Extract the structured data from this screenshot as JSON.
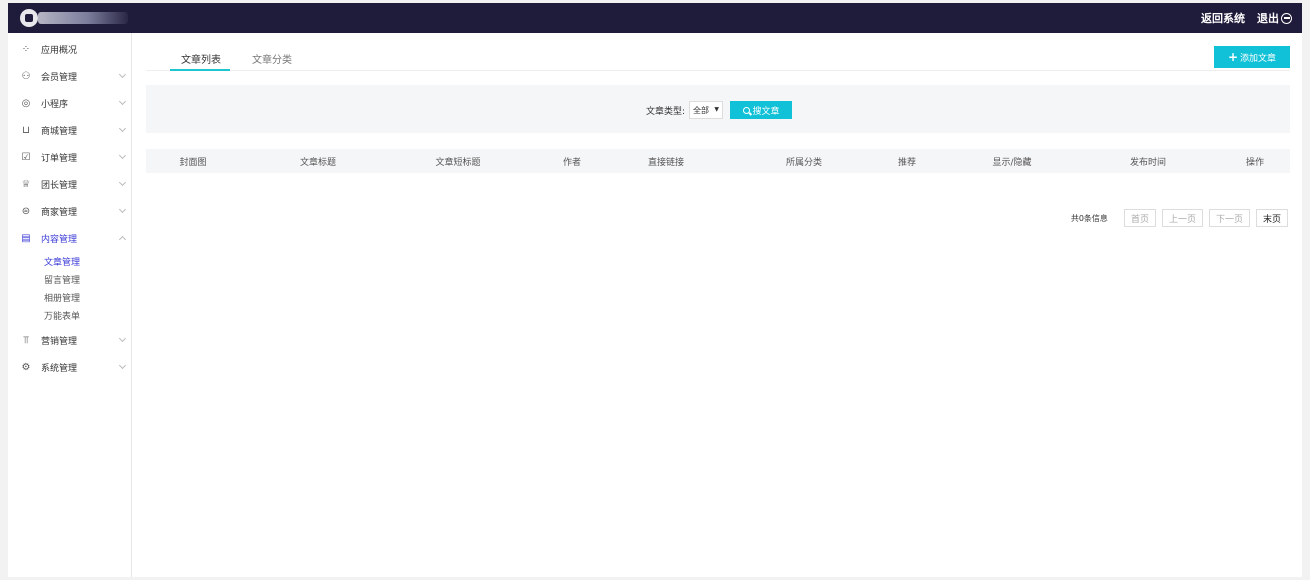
{
  "header": {
    "return_label": "返回系统",
    "logout_label": "退出"
  },
  "sidebar": {
    "items": [
      {
        "label": "应用概况",
        "icon": "dashboard-icon",
        "chevron": false
      },
      {
        "label": "会员管理",
        "icon": "users-icon",
        "chevron": true
      },
      {
        "label": "小程序",
        "icon": "mini-program-icon",
        "chevron": true
      },
      {
        "label": "商城管理",
        "icon": "cart-icon",
        "chevron": true
      },
      {
        "label": "订单管理",
        "icon": "order-icon",
        "chevron": true
      },
      {
        "label": "团长管理",
        "icon": "crown-icon",
        "chevron": true
      },
      {
        "label": "商家管理",
        "icon": "store-icon",
        "chevron": true
      },
      {
        "label": "内容管理",
        "icon": "document-icon",
        "chevron": true,
        "expanded": true,
        "active": true
      },
      {
        "label": "营销管理",
        "icon": "chart-icon",
        "chevron": true
      },
      {
        "label": "系统管理",
        "icon": "settings-icon",
        "chevron": true
      }
    ],
    "content_sub_items": [
      {
        "label": "文章管理",
        "active": true
      },
      {
        "label": "留言管理"
      },
      {
        "label": "相册管理"
      },
      {
        "label": "万能表单"
      }
    ]
  },
  "main": {
    "tabs": [
      {
        "label": "文章列表",
        "active": true
      },
      {
        "label": "文章分类"
      }
    ],
    "add_button_label": "添加文章",
    "filter": {
      "type_label": "文章类型:",
      "type_selected": "全部",
      "search_label": "搜文章"
    },
    "table": {
      "columns": [
        "封面图",
        "文章标题",
        "文章短标题",
        "作者",
        "直接链接",
        "所属分类",
        "推荐",
        "显示/隐藏",
        "发布时间",
        "操作"
      ],
      "rows": []
    },
    "pagination": {
      "total_text": "共0条信息",
      "first": "首页",
      "prev": "上一页",
      "next": "下一页",
      "last": "末页"
    }
  },
  "colors": {
    "topbar": "#1f1b3a",
    "accent": "#10c1d7",
    "active_nav": "#3a3ad6"
  }
}
